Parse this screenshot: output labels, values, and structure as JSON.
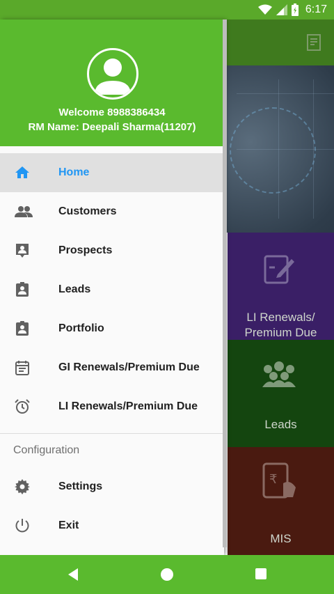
{
  "status_bar": {
    "time": "6:17"
  },
  "drawer": {
    "welcome_text": "Welcome 8988386434",
    "rm_name": "RM Name: Deepali Sharma(11207)",
    "items": [
      {
        "label": "Home",
        "icon": "home-icon",
        "active": true
      },
      {
        "label": "Customers",
        "icon": "people-icon"
      },
      {
        "label": "Prospects",
        "icon": "contact-mail-icon"
      },
      {
        "label": "Leads",
        "icon": "assignment-ind-icon"
      },
      {
        "label": "Portfolio",
        "icon": "portfolio-icon"
      },
      {
        "label": "GI Renewals/Premium Due",
        "icon": "calendar-icon"
      },
      {
        "label": "LI Renewals/Premium Due",
        "icon": "alarm-icon"
      }
    ],
    "config_title": "Configuration",
    "config_items": [
      {
        "label": "Settings",
        "icon": "gear-icon"
      },
      {
        "label": "Exit",
        "icon": "power-icon"
      }
    ]
  },
  "background": {
    "tiles": [
      {
        "label_line1": "LI Renewals/",
        "label_line2": "Premium Due"
      },
      {
        "label": "Leads"
      },
      {
        "label": "MIS"
      }
    ]
  },
  "colors": {
    "primary": "#5aba2e",
    "active_text": "#2196f3"
  }
}
